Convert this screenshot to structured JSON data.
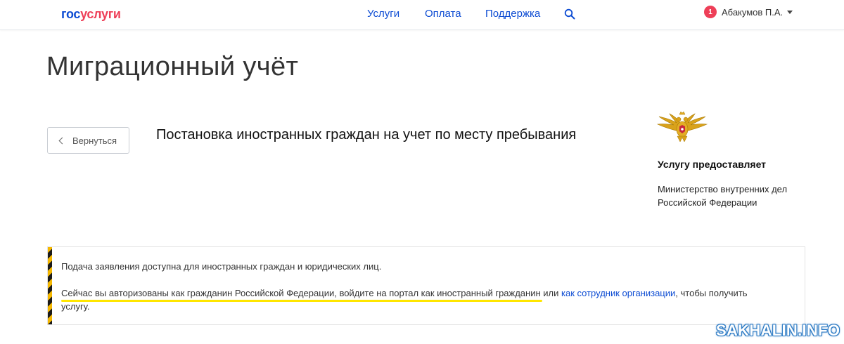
{
  "header": {
    "logo_part1": "гос",
    "logo_part2": "услуги",
    "nav": {
      "services": "Услуги",
      "payment": "Оплата",
      "support": "Поддержка"
    },
    "search_icon": "search-icon",
    "user": {
      "badge_count": "1",
      "name": "Абакумов П.А."
    }
  },
  "page": {
    "title": "Миграционный учёт"
  },
  "back_button": {
    "label": "Вернуться"
  },
  "service": {
    "title": "Постановка иностранных граждан на учет по месту пребывания"
  },
  "provider": {
    "heading": "Услугу предоставляет",
    "name": "Министерство внутренних дел Российской Федерации",
    "emblem_icon": "double-headed-eagle-emblem"
  },
  "notice": {
    "line1": "Подача заявления доступна для иностранных граждан и юридических лиц.",
    "line2_part1": "Сейчас вы авторизованы как гражданин Российской Федерации, войдите на портал как иностранный гражданин",
    "line2_part2": " или ",
    "line2_link": "как сотрудник организации",
    "line2_part3": ", чтобы получить услугу."
  },
  "watermark": "SAKHALIN.INFO",
  "colors": {
    "brand_blue": "#0d4cd3",
    "brand_red": "#ee3f58",
    "highlight_yellow": "#ffe600",
    "stripe_yellow": "#f5b800"
  }
}
